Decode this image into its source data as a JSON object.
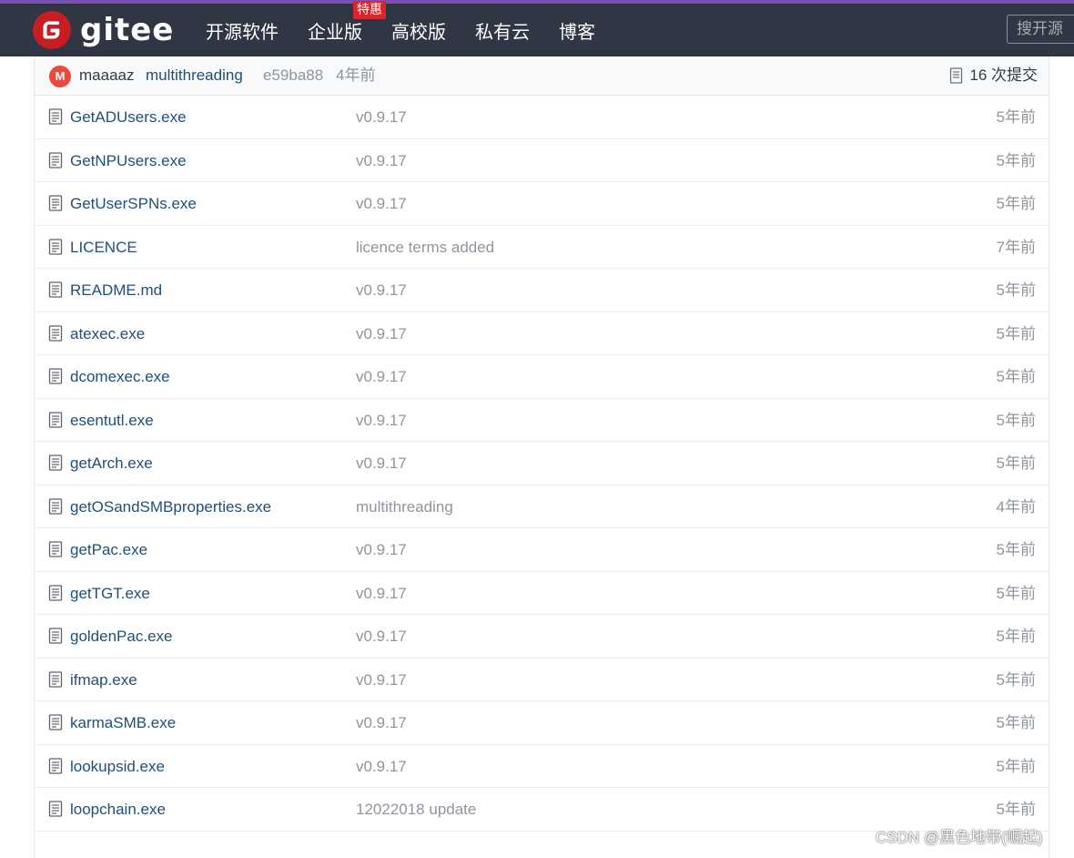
{
  "colors": {
    "navbar_bg": "#303643",
    "brand_red": "#c71d23",
    "accent_purple": "#7b4fb3",
    "link_blue": "#1f4f7a",
    "muted_gray": "#8f959e"
  },
  "navbar": {
    "logo_text": "gitee",
    "items": [
      {
        "label": "开源软件"
      },
      {
        "label": "企业版",
        "badge": "特惠"
      },
      {
        "label": "高校版"
      },
      {
        "label": "私有云"
      },
      {
        "label": "博客"
      }
    ],
    "search_placeholder": "搜开源"
  },
  "commit_bar": {
    "avatar_letter": "M",
    "author": "maaaaz",
    "message": "multithreading",
    "hash": "e59ba88",
    "time": "4年前",
    "commits": "16 次提交"
  },
  "files": [
    {
      "name": "GetADUsers.exe",
      "message": "v0.9.17",
      "time": "5年前"
    },
    {
      "name": "GetNPUsers.exe",
      "message": "v0.9.17",
      "time": "5年前"
    },
    {
      "name": "GetUserSPNs.exe",
      "message": "v0.9.17",
      "time": "5年前"
    },
    {
      "name": "LICENCE",
      "message": "licence terms added",
      "time": "7年前"
    },
    {
      "name": "README.md",
      "message": "v0.9.17",
      "time": "5年前"
    },
    {
      "name": "atexec.exe",
      "message": "v0.9.17",
      "time": "5年前"
    },
    {
      "name": "dcomexec.exe",
      "message": "v0.9.17",
      "time": "5年前"
    },
    {
      "name": "esentutl.exe",
      "message": "v0.9.17",
      "time": "5年前"
    },
    {
      "name": "getArch.exe",
      "message": "v0.9.17",
      "time": "5年前"
    },
    {
      "name": "getOSandSMBproperties.exe",
      "message": "multithreading",
      "time": "4年前"
    },
    {
      "name": "getPac.exe",
      "message": "v0.9.17",
      "time": "5年前"
    },
    {
      "name": "getTGT.exe",
      "message": "v0.9.17",
      "time": "5年前"
    },
    {
      "name": "goldenPac.exe",
      "message": "v0.9.17",
      "time": "5年前"
    },
    {
      "name": "ifmap.exe",
      "message": "v0.9.17",
      "time": "5年前"
    },
    {
      "name": "karmaSMB.exe",
      "message": "v0.9.17",
      "time": "5年前"
    },
    {
      "name": "lookupsid.exe",
      "message": "v0.9.17",
      "time": "5年前"
    },
    {
      "name": "loopchain.exe",
      "message": "12022018 update",
      "time": "5年前"
    }
  ],
  "watermark": "CSDN @黑色地带(崛起)"
}
